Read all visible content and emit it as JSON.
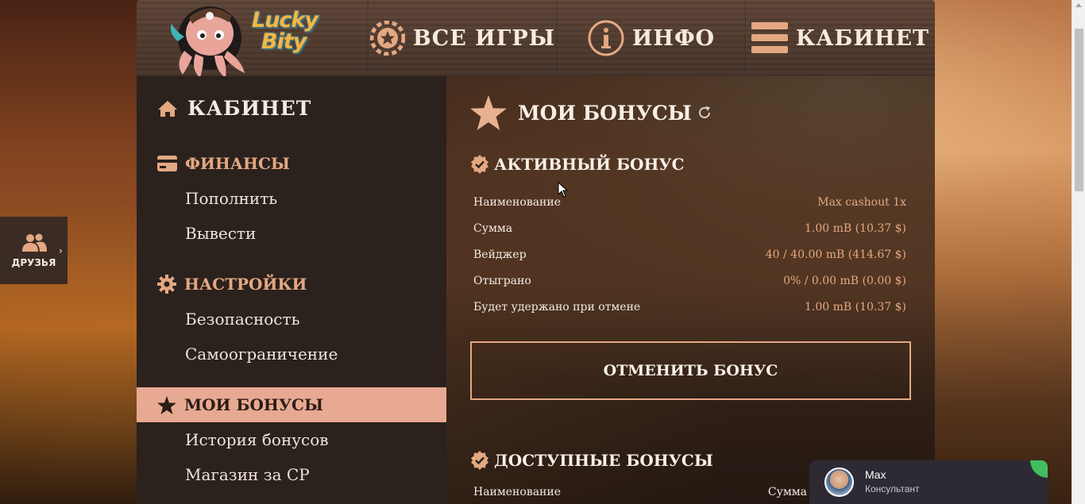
{
  "header": {
    "brand_line1": "Lucky",
    "brand_line2": "Bity",
    "nav": {
      "games": "ВСЕ ИГРЫ",
      "info": "ИНФО",
      "cabinet": "КАБИНЕТ"
    }
  },
  "sidebar": {
    "title": "КАБИНЕТ",
    "finances": {
      "heading": "ФИНАНСЫ",
      "deposit": "Пополнить",
      "withdraw": "Вывести"
    },
    "settings": {
      "heading": "НАСТРОЙКИ",
      "security": "Безопасность",
      "self_limit": "Самоограничение"
    },
    "active_item": "МОИ БОНУСЫ",
    "bonus_history": "История бонусов",
    "cp_shop": "Магазин за СР"
  },
  "main": {
    "title": "МОИ БОНУСЫ",
    "active_bonus": {
      "heading": "АКТИВНЫЙ БОНУС",
      "rows": [
        {
          "label": "Наименование",
          "value": "Max cashout 1x"
        },
        {
          "label": "Сумма",
          "value": "1.00 mB (10.37 $)"
        },
        {
          "label": "Вейджер",
          "value": "40 / 40.00 mB (414.67 $)"
        },
        {
          "label": "Отыграно",
          "value": "0% / 0.00 mB (0.00 $)"
        },
        {
          "label": "Будет удержано при отмене",
          "value": "1.00 mB (10.37 $)"
        }
      ],
      "cancel_label": "ОТМЕНИТЬ БОНУС"
    },
    "available_bonuses": {
      "heading": "ДОСТУПНЫЕ БОНУСЫ",
      "col_name": "Наименование",
      "col_sum": "Сумма"
    }
  },
  "friends_tab": {
    "label": "ДРУЗЬЯ"
  },
  "chat": {
    "name": "Max",
    "role": "Консультант",
    "online_color": "#3fbf5f"
  },
  "colors": {
    "accent": "#e3a882",
    "active_bg": "#e8a992",
    "sidebar_bg": "#2b211d"
  }
}
